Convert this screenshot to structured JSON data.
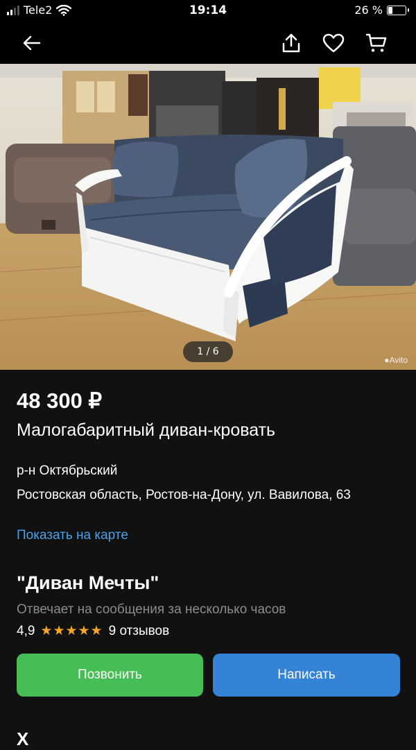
{
  "status_bar": {
    "carrier": "Tele2",
    "time": "19:14",
    "battery": "26 %",
    "battery_level": 0.26
  },
  "nav": {
    "back_icon": "arrow-left-icon",
    "share_icon": "share-icon",
    "favorite_icon": "heart-icon",
    "cart_icon": "cart-icon"
  },
  "gallery": {
    "counter": "1 / 6",
    "watermark": "Avito"
  },
  "listing": {
    "price": "48 300 ₽",
    "title": "Малогабаритный диван-кровать",
    "district": "р-н Октябрьский",
    "address": "Ростовская область, Ростов-на-Дону, ул. Вавилова, 63",
    "map_link": "Показать на карте"
  },
  "seller": {
    "name": "\"Диван Мечты\"",
    "response_time": "Отвечает на сообщения за несколько часов",
    "rating": "4,9",
    "stars": "★★★★★",
    "reviews": "9 отзывов"
  },
  "actions": {
    "call": "Позвонить",
    "write": "Написать"
  },
  "next_section": {
    "heading": "Х"
  },
  "colors": {
    "background": "#111111",
    "link": "#4aa0e6",
    "call_button": "#47bd55",
    "write_button": "#3483d7",
    "stars": "#f5a623"
  }
}
